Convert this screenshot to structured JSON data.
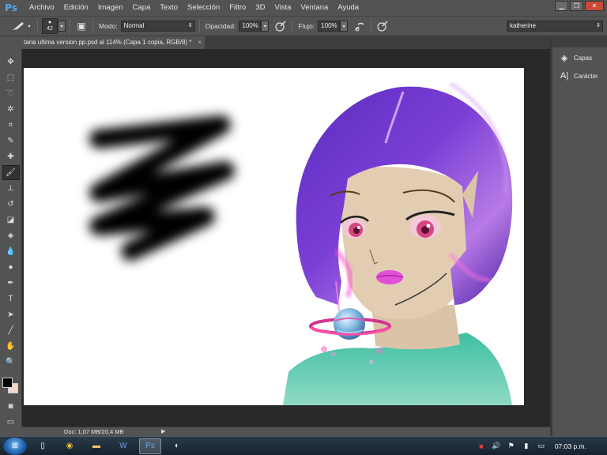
{
  "menubar": {
    "logo": "Ps",
    "items": [
      "Archivo",
      "Edición",
      "Imagen",
      "Capa",
      "Texto",
      "Selección",
      "Filtro",
      "3D",
      "Vista",
      "Ventana",
      "Ayuda"
    ]
  },
  "options": {
    "brush_size": "42",
    "mode_label": "Modo:",
    "mode_value": "Normal",
    "opacity_label": "Opacidad:",
    "opacity_value": "100%",
    "flow_label": "Flujo:",
    "flow_value": "100%",
    "workspace_value": "katherine"
  },
  "document": {
    "tab_title": "taria ultima version pp.psd al 114% (Capa 1 copia, RGB/8) *",
    "close": "×"
  },
  "status": {
    "doc_info": "Doc: 1,07 MB/20,4 MB"
  },
  "panels": {
    "layers_label": "Capas",
    "character_label": "Carácter"
  },
  "taskbar": {
    "clock": "07:03 p.m."
  },
  "colors": {
    "foreground": "#000000",
    "background": "#eed9cc",
    "ui_background": "#535353",
    "workspace": "#282828"
  },
  "icons": {
    "tools": [
      "move-icon",
      "marquee-icon",
      "lasso-icon",
      "quick-select-icon",
      "crop-icon",
      "eyedropper-icon",
      "healing-icon",
      "brush-icon",
      "stamp-icon",
      "history-brush-icon",
      "eraser-icon",
      "bucket-icon",
      "blur-icon",
      "dodge-icon",
      "pen-icon",
      "type-icon",
      "path-select-icon",
      "line-icon",
      "hand-icon",
      "zoom-icon"
    ]
  }
}
